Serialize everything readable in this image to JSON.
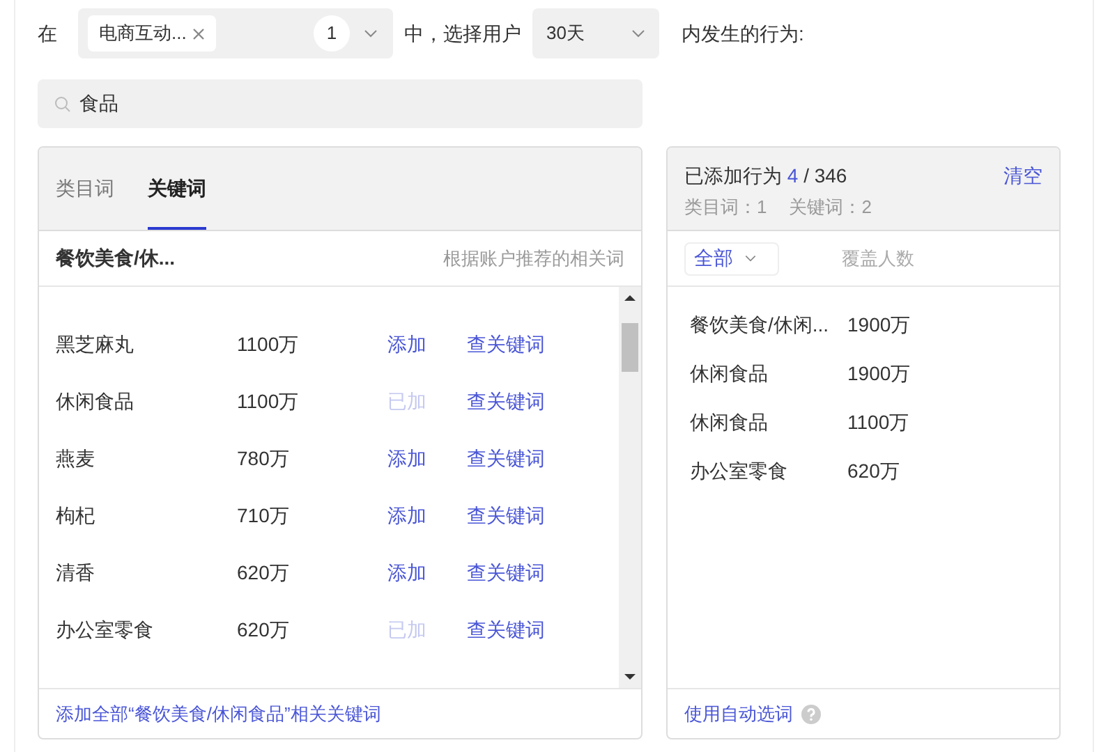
{
  "filter": {
    "prefix": "在",
    "source_tag": "电商互动...",
    "tag_count": "1",
    "middle": "中，选择用户",
    "period": "30天",
    "suffix": "内发生的行为:"
  },
  "search": {
    "value": "食品"
  },
  "tabs": [
    {
      "label": "类目词",
      "selected": false
    },
    {
      "label": "关键词",
      "selected": true
    }
  ],
  "list_header": {
    "category": "餐饮美食/休...",
    "hint": "根据账户推荐的相关词"
  },
  "rows": [
    {
      "word": "黑芝麻丸",
      "count": "1100万",
      "action": "添加",
      "added": false,
      "link": "查关键词"
    },
    {
      "word": "休闲食品",
      "count": "1100万",
      "action": "已加",
      "added": true,
      "link": "查关键词"
    },
    {
      "word": "燕麦",
      "count": "780万",
      "action": "添加",
      "added": false,
      "link": "查关键词"
    },
    {
      "word": "枸杞",
      "count": "710万",
      "action": "添加",
      "added": false,
      "link": "查关键词"
    },
    {
      "word": "清香",
      "count": "620万",
      "action": "添加",
      "added": false,
      "link": "查关键词"
    },
    {
      "word": "办公室零食",
      "count": "620万",
      "action": "已加",
      "added": true,
      "link": "查关键词"
    }
  ],
  "add_all_link": "添加全部“餐饮美食/休闲食品”相关关键词",
  "summary": {
    "label": "已添加行为",
    "count": "4",
    "total": "/ 346",
    "clear": "清空",
    "category_count": "类目词：1",
    "keyword_count": "关键词：2"
  },
  "selected_filter": {
    "value": "全部",
    "column": "覆盖人数"
  },
  "selected": [
    {
      "word": "餐饮美食/休闲...",
      "count": "1900万"
    },
    {
      "word": "休闲食品",
      "count": "1900万"
    },
    {
      "word": "休闲食品",
      "count": "1100万"
    },
    {
      "word": "办公室零食",
      "count": "620万"
    }
  ],
  "auto_select_link": "使用自动选词"
}
